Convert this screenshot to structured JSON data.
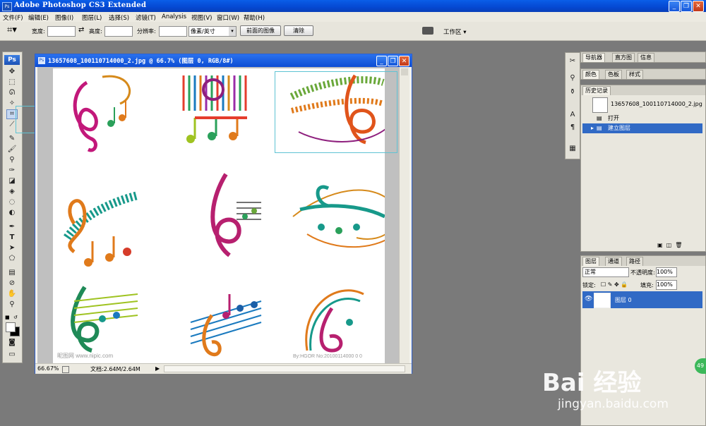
{
  "app": {
    "title": "Adobe Photoshop CS3 Extended",
    "window_min": "_",
    "window_restore": "❐",
    "window_close": "✕"
  },
  "menu": [
    "文件(F)",
    "编辑(E)",
    "图像(I)",
    "图层(L)",
    "选择(S)",
    "滤镜(T)",
    "Analysis",
    "视图(V)",
    "窗口(W)",
    "帮助(H)"
  ],
  "options": {
    "width_label": "宽度:",
    "height_label": "高度:",
    "resolution_label": "分辨率:",
    "units_value": "像素/英寸",
    "front_image_button": "前面的图像",
    "clear_button": "清除",
    "workspace_label": "工作区 ▾"
  },
  "toolbox": {
    "logo": "Ps"
  },
  "document": {
    "title": "13657608_100110714000_2.jpg @ 66.7% (图层 0, RGB/8#)",
    "zoom": "66.67%",
    "doc_info": "文档:2.64M/2.64M",
    "canvas_footer_left": "昵图网 www.nipic.com",
    "canvas_footer_right": "By:HGOR No:20100114000 0 0"
  },
  "panels": {
    "top_tabs": [
      "导航器",
      "直方图",
      "信息"
    ],
    "mid_tabs": [
      "颜色",
      "色板",
      "样式"
    ],
    "history_tab": "历史记录",
    "history_snapshot": "13657608_100110714000_2.jpg",
    "history_items": [
      {
        "label": "打开",
        "selected": false
      },
      {
        "label": "建立图层",
        "selected": true
      }
    ],
    "layers_tabs": [
      "图层",
      "通道",
      "路径"
    ],
    "blend_mode": "正常",
    "opacity_label": "不透明度:",
    "opacity_value": "100%",
    "lock_label": "锁定:",
    "fill_label": "填充:",
    "fill_value": "100%",
    "layer_name": "图层 0"
  },
  "watermark": {
    "brand": "Bai 经验",
    "url": "jingyan.baidu.com",
    "badge": "49"
  },
  "colors": {
    "title_blue": "#0548d2",
    "selection_blue": "#316ac5",
    "workspace_gray": "#7a7a7a"
  }
}
